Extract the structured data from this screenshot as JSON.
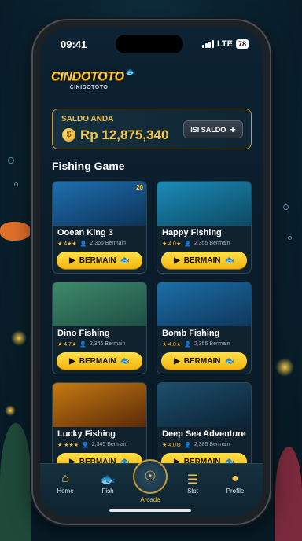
{
  "status": {
    "time": "09:41",
    "network": "LTE",
    "battery": "78"
  },
  "brand": {
    "name": "CINDOTOTO",
    "subtitle": "CIKIDOTOTO"
  },
  "balance": {
    "label": "SALDO ANDA",
    "amount": "Rp 12,875,340",
    "coin_symbol": "$",
    "topup_label": "ISI SALDO",
    "topup_icon": "+"
  },
  "section": {
    "title": "Fishing Game"
  },
  "games": [
    {
      "title": "Ooean King 3",
      "rating": "★ 4★★",
      "players": "2,366 Bermain",
      "badge": "20",
      "button": "BERMAIN",
      "colors": [
        "#1e6fb0",
        "#0e3358"
      ]
    },
    {
      "title": "Happy Fishing",
      "rating": "★ 4.0★",
      "players": "2,355 Bermain",
      "badge": "",
      "button": "BERMAIN",
      "colors": [
        "#1b8bb8",
        "#0d4a63"
      ]
    },
    {
      "title": "Dino Fishing",
      "rating": "★ 4.7★",
      "players": "2,346 Bermain",
      "badge": "",
      "button": "BERMAIN",
      "colors": [
        "#3e8a6b",
        "#1f4f44"
      ]
    },
    {
      "title": "Bomb Fishing",
      "rating": "★ 4.0★",
      "players": "2,355 Bermain",
      "badge": "",
      "button": "BERMAIN",
      "colors": [
        "#1b6fa8",
        "#10375c"
      ]
    },
    {
      "title": "Lucky Fishing",
      "rating": "★ ★★★",
      "players": "2,345 Bermain",
      "badge": "",
      "button": "BERMAIN",
      "colors": [
        "#c67a12",
        "#5a2a08"
      ]
    },
    {
      "title": "Deep Sea Adventure",
      "rating": "★ 4.0⚙",
      "players": "2,385 Bermain",
      "badge": "",
      "button": "BERMAIN",
      "colors": [
        "#1d4f6e",
        "#0b2233"
      ]
    }
  ],
  "tabs": [
    {
      "label": "Home",
      "icon": "home-icon"
    },
    {
      "label": "Fish",
      "icon": "fish-icon"
    },
    {
      "label": "Arcade",
      "icon": "arcade-icon"
    },
    {
      "label": "Slot",
      "icon": "slot-icon"
    },
    {
      "label": "Profile",
      "icon": "profile-icon"
    }
  ],
  "colors": {
    "accent": "#f3c14a",
    "button": "#ffd531"
  }
}
